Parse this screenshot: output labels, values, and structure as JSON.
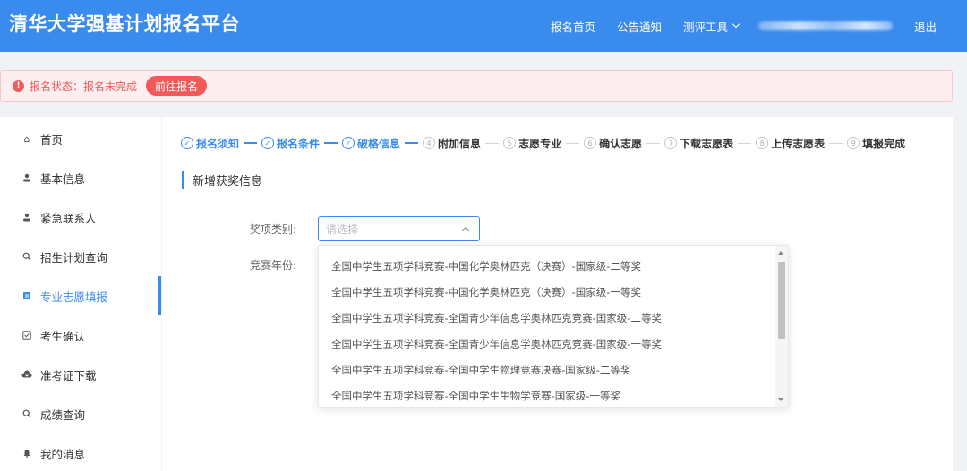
{
  "header": {
    "title": "清华大学强基计划报名平台",
    "nav": [
      "报名首页",
      "公告通知",
      "测评工具"
    ],
    "logout": "退出"
  },
  "alert": {
    "icon": "!",
    "text": "报名状态：报名未完成",
    "button": "前往报名"
  },
  "sidebar": {
    "items": [
      {
        "label": "首页",
        "icon": "home-icon",
        "glyph": "⌂"
      },
      {
        "label": "基本信息",
        "icon": "user-icon",
        "glyph": "👤"
      },
      {
        "label": "紧急联系人",
        "icon": "user-icon",
        "glyph": "👤"
      },
      {
        "label": "招生计划查询",
        "icon": "search-icon",
        "glyph": "⚲"
      },
      {
        "label": "专业志愿填报",
        "icon": "document-icon",
        "glyph": "▤"
      },
      {
        "label": "考生确认",
        "icon": "checkbox-icon",
        "glyph": "☑"
      },
      {
        "label": "准考证下载",
        "icon": "cloud-download-icon",
        "glyph": "☁"
      },
      {
        "label": "成绩查询",
        "icon": "search-icon",
        "glyph": "⚲"
      },
      {
        "label": "我的消息",
        "icon": "bell-icon",
        "glyph": "🔔"
      }
    ],
    "active_index": 4
  },
  "steps": [
    {
      "num": "✓",
      "label": "报名须知",
      "done": true
    },
    {
      "num": "✓",
      "label": "报名条件",
      "done": true
    },
    {
      "num": "✓",
      "label": "破格信息",
      "done": true
    },
    {
      "num": "4",
      "label": "附加信息",
      "done": false
    },
    {
      "num": "5",
      "label": "志愿专业",
      "done": false
    },
    {
      "num": "6",
      "label": "确认志愿",
      "done": false
    },
    {
      "num": "7",
      "label": "下载志愿表",
      "done": false
    },
    {
      "num": "8",
      "label": "上传志愿表",
      "done": false
    },
    {
      "num": "9",
      "label": "填报完成",
      "done": false
    }
  ],
  "section_title": "新增获奖信息",
  "form": {
    "award_type_label": "奖项类别:",
    "award_type_placeholder": "请选择",
    "year_label": "竞赛年份:"
  },
  "dropdown_options": [
    "全国中学生五项学科竞赛-中国化学奥林匹克（决赛）-国家级-二等奖",
    "全国中学生五项学科竞赛-中国化学奥林匹克（决赛）-国家级-一等奖",
    "全国中学生五项学科竞赛-全国青少年信息学奥林匹克竞赛-国家级-二等奖",
    "全国中学生五项学科竞赛-全国青少年信息学奥林匹克竞赛-国家级-一等奖",
    "全国中学生五项学科竞赛-全国中学生物理竞赛决赛-国家级-二等奖",
    "全国中学生五项学科竞赛-全国中学生生物学竞赛-国家级-一等奖"
  ],
  "colors": {
    "primary": "#3a8bee",
    "alert": "#f25a5a",
    "alert_bg": "#fdeeef"
  }
}
